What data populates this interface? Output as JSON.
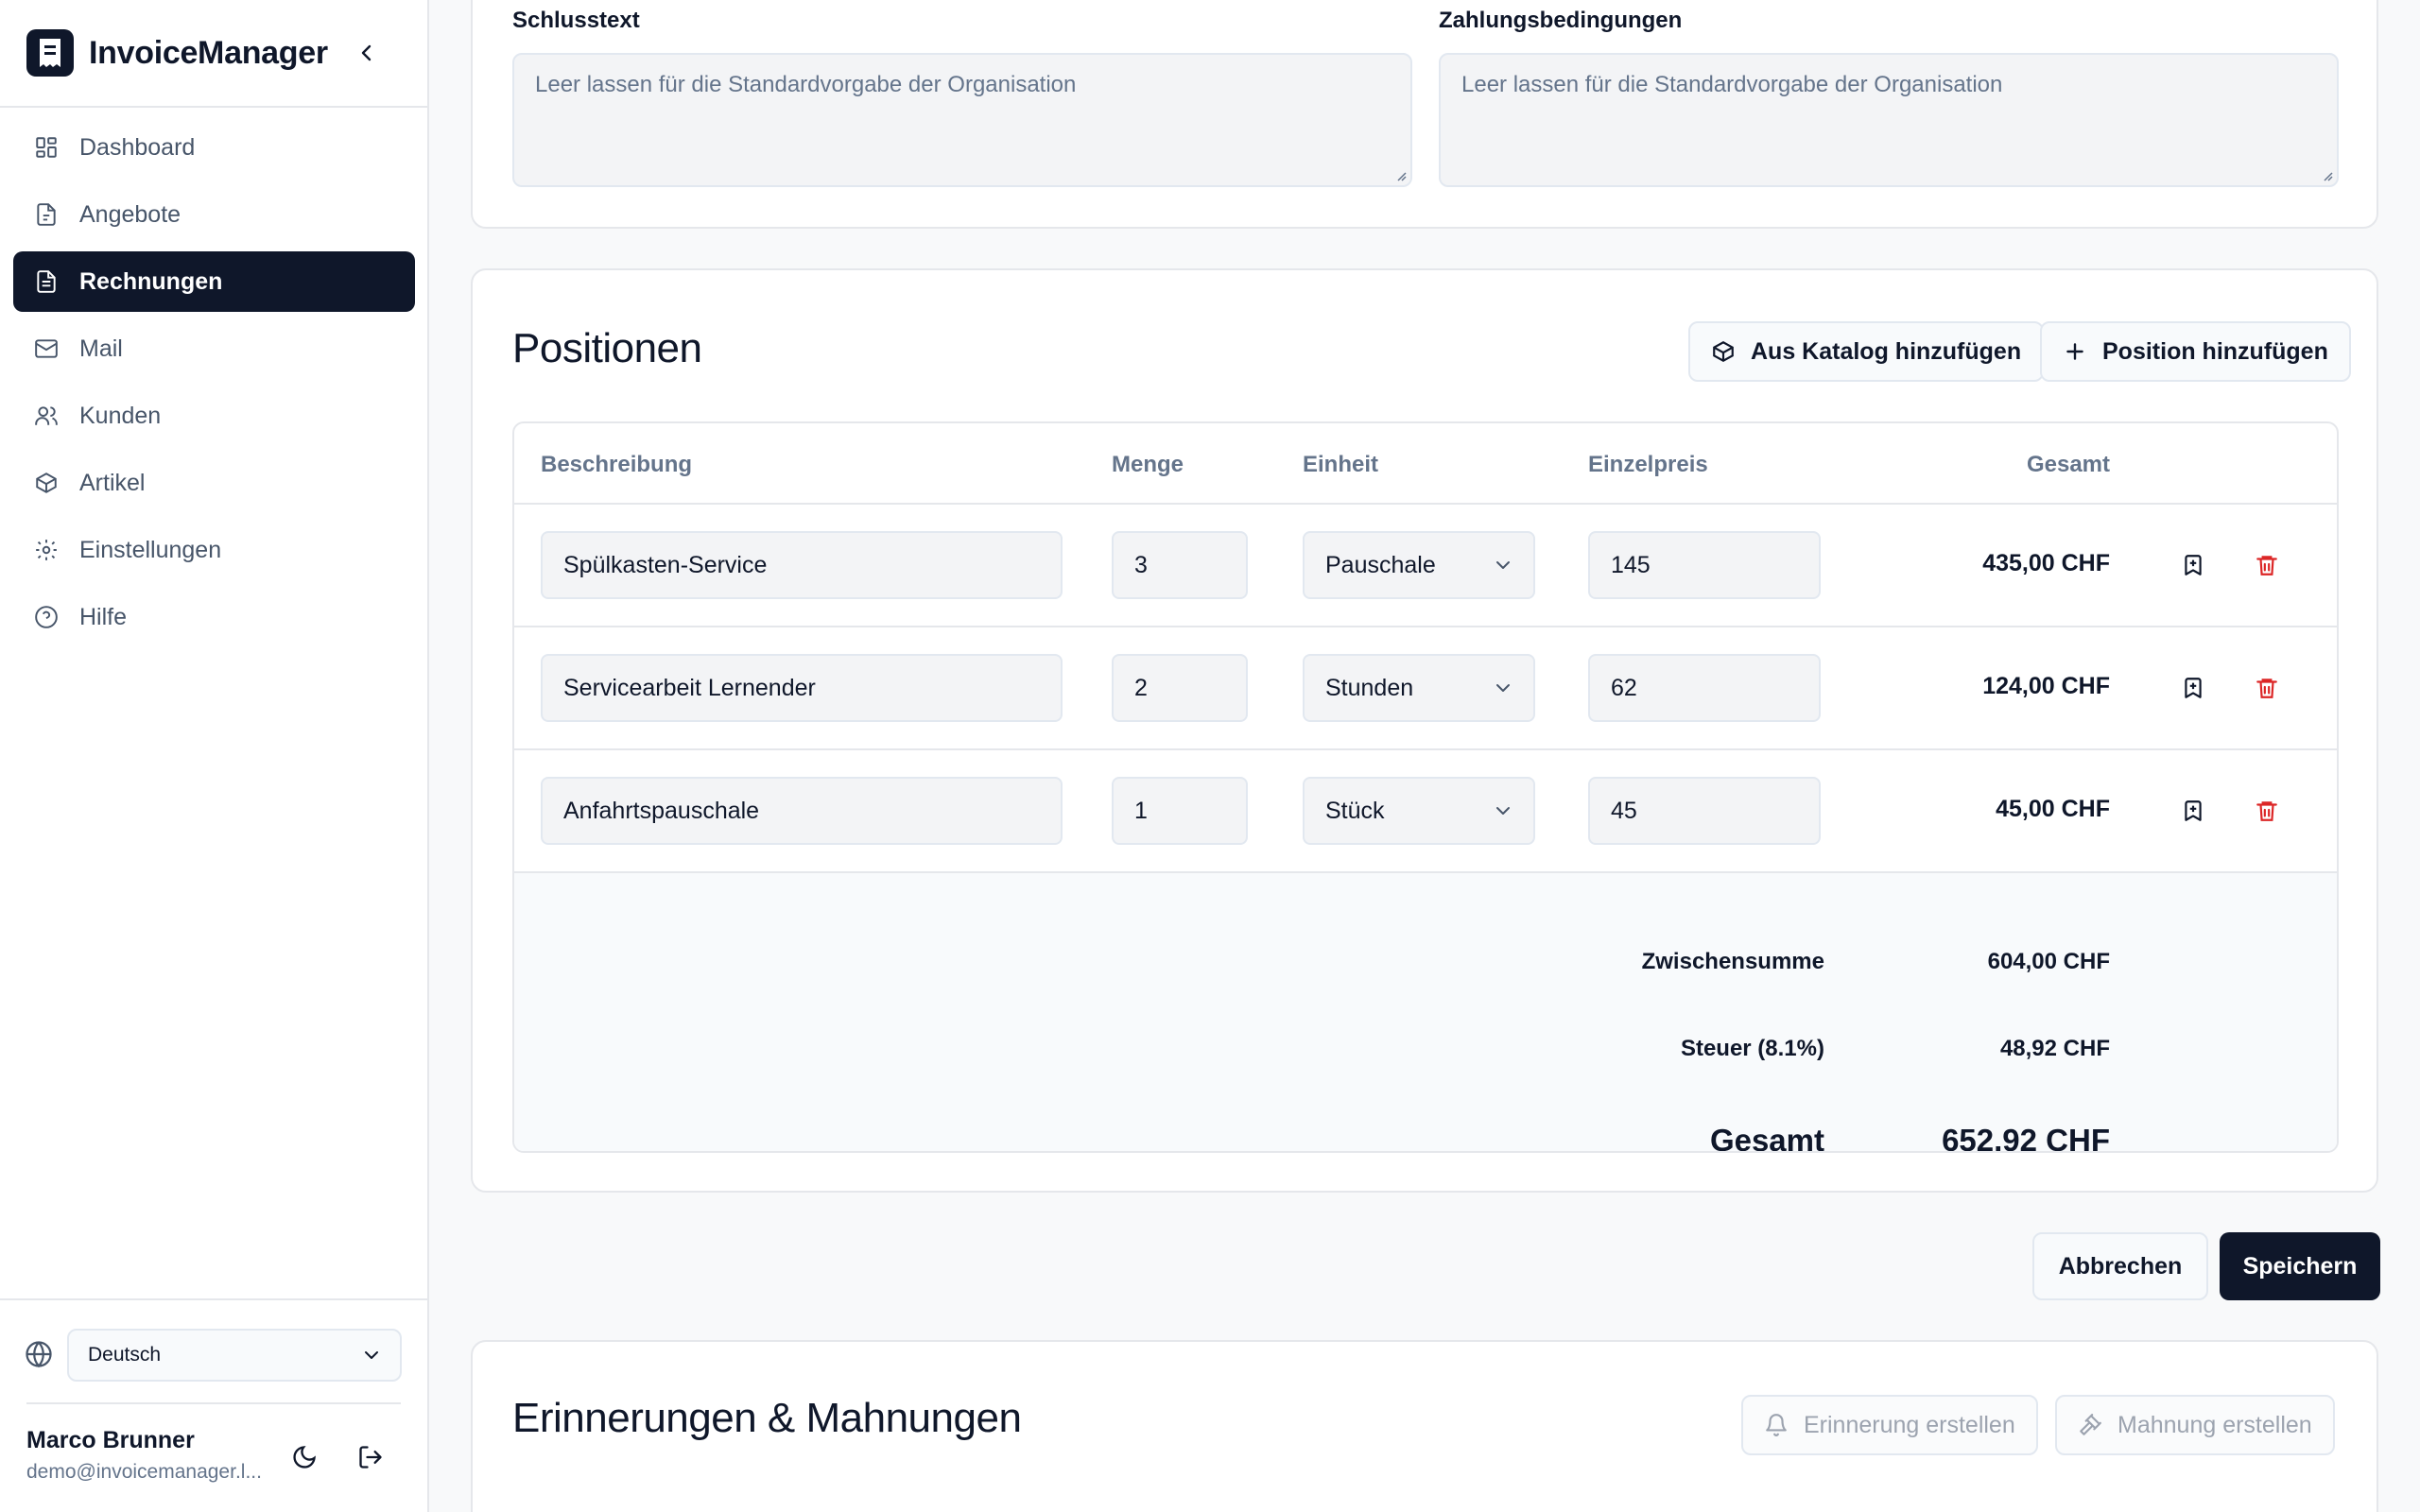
{
  "app": {
    "name": "InvoiceManager"
  },
  "sidebar": {
    "items": [
      {
        "label": "Dashboard",
        "icon": "dashboard-icon"
      },
      {
        "label": "Angebote",
        "icon": "document-icon"
      },
      {
        "label": "Rechnungen",
        "icon": "invoice-icon",
        "active": true
      },
      {
        "label": "Mail",
        "icon": "mail-icon"
      },
      {
        "label": "Kunden",
        "icon": "users-icon"
      },
      {
        "label": "Artikel",
        "icon": "package-icon"
      },
      {
        "label": "Einstellungen",
        "icon": "gear-icon"
      },
      {
        "label": "Hilfe",
        "icon": "help-icon"
      }
    ],
    "language": "Deutsch",
    "user": {
      "name": "Marco Brunner",
      "email": "demo@invoicemanager.l..."
    }
  },
  "texts": {
    "closing_label": "Schlusstext",
    "closing_placeholder": "Leer lassen für die Standardvorgabe der Organisation",
    "terms_label": "Zahlungsbedingungen",
    "terms_placeholder": "Leer lassen für die Standardvorgabe der Organisation"
  },
  "positions": {
    "title": "Positionen",
    "catalog_button": "Aus Katalog hinzufügen",
    "add_button": "Position hinzufügen",
    "columns": {
      "description": "Beschreibung",
      "quantity": "Menge",
      "unit": "Einheit",
      "unit_price": "Einzelpreis",
      "total": "Gesamt"
    },
    "rows": [
      {
        "description": "Spülkasten-Service",
        "quantity": "3",
        "unit": "Pauschale",
        "unit_price": "145",
        "total": "435,00 CHF"
      },
      {
        "description": "Servicearbeit Lernender",
        "quantity": "2",
        "unit": "Stunden",
        "unit_price": "62",
        "total": "124,00 CHF"
      },
      {
        "description": "Anfahrtspauschale",
        "quantity": "1",
        "unit": "Stück",
        "unit_price": "45",
        "total": "45,00 CHF"
      }
    ],
    "summary": {
      "subtotal_label": "Zwischensumme",
      "subtotal": "604,00 CHF",
      "tax_label": "Steuer (8.1%)",
      "tax": "48,92 CHF",
      "total_label": "Gesamt",
      "total": "652,92 CHF"
    }
  },
  "actions": {
    "cancel": "Abbrechen",
    "save": "Speichern"
  },
  "reminders": {
    "title": "Erinnerungen & Mahnungen",
    "reminder_button": "Erinnerung erstellen",
    "dunning_button": "Mahnung erstellen"
  },
  "colors": {
    "primary": "#0f172a",
    "danger": "#dc2626",
    "muted": "#64748b"
  }
}
